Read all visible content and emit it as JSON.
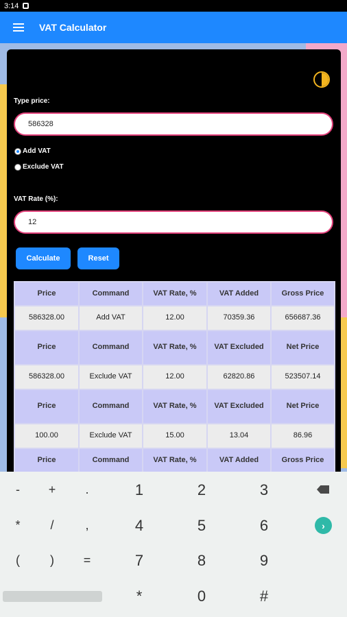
{
  "status": {
    "time": "3:14"
  },
  "app": {
    "title": "VAT Calculator"
  },
  "form": {
    "price_label": "Type price:",
    "price_value": "586328",
    "add_vat_label": "Add VAT",
    "exclude_vat_label": "Exclude VAT",
    "selected_mode": "Add VAT",
    "rate_label": "VAT Rate (%):",
    "rate_value": "12",
    "calculate_label": "Calculate",
    "reset_label": "Reset"
  },
  "results": [
    {
      "headers": [
        "Price",
        "Command",
        "VAT Rate, %",
        "VAT Added",
        "Gross Price"
      ],
      "row": [
        "586328.00",
        "Add VAT",
        "12.00",
        "70359.36",
        "656687.36"
      ]
    },
    {
      "headers": [
        "Price",
        "Command",
        "VAT Rate, %",
        "VAT Excluded",
        "Net Price"
      ],
      "row": [
        "586328.00",
        "Exclude VAT",
        "12.00",
        "62820.86",
        "523507.14"
      ]
    },
    {
      "headers": [
        "Price",
        "Command",
        "VAT Rate, %",
        "VAT Excluded",
        "Net Price"
      ],
      "row": [
        "100.00",
        "Exclude VAT",
        "15.00",
        "13.04",
        "86.96"
      ]
    },
    {
      "headers": [
        "Price",
        "Command",
        "VAT Rate, %",
        "VAT Added",
        "Gross Price"
      ]
    }
  ],
  "keyboard": {
    "row1": [
      "-",
      "+",
      ".",
      "1",
      "2",
      "3"
    ],
    "row2": [
      "*",
      "/",
      ",",
      "4",
      "5",
      "6"
    ],
    "row3": [
      "(",
      ")",
      "=",
      "7",
      "8",
      "9"
    ],
    "row4": [
      "*",
      "0",
      "#"
    ],
    "go_symbol": "›"
  }
}
